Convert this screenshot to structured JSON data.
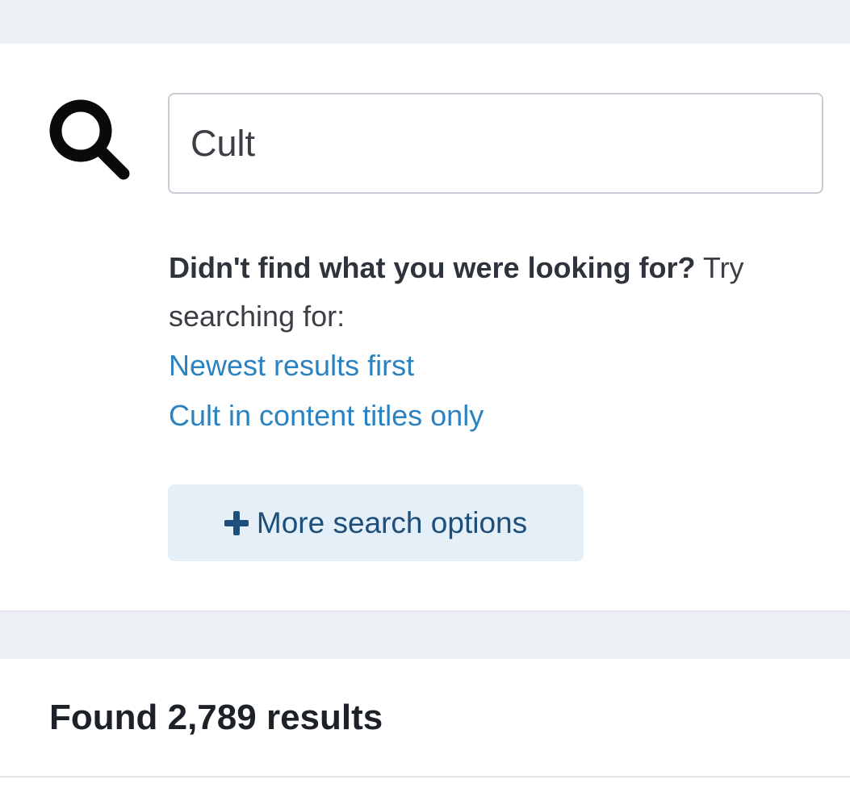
{
  "search": {
    "value": "Cult",
    "icon": "search-icon"
  },
  "suggestions": {
    "bold_text": "Didn't find what you were looking for?",
    "normal_text": " Try searching for:",
    "links": [
      "Newest results first",
      "Cult in content titles only"
    ]
  },
  "more_options": {
    "label": "More search options",
    "icon": "plus-icon"
  },
  "results": {
    "count_text": "Found 2,789 results"
  },
  "colors": {
    "page_background": "#eceff4",
    "link": "#2b82c0",
    "button_background": "#e4eff8",
    "button_text": "#1d4f7a"
  }
}
